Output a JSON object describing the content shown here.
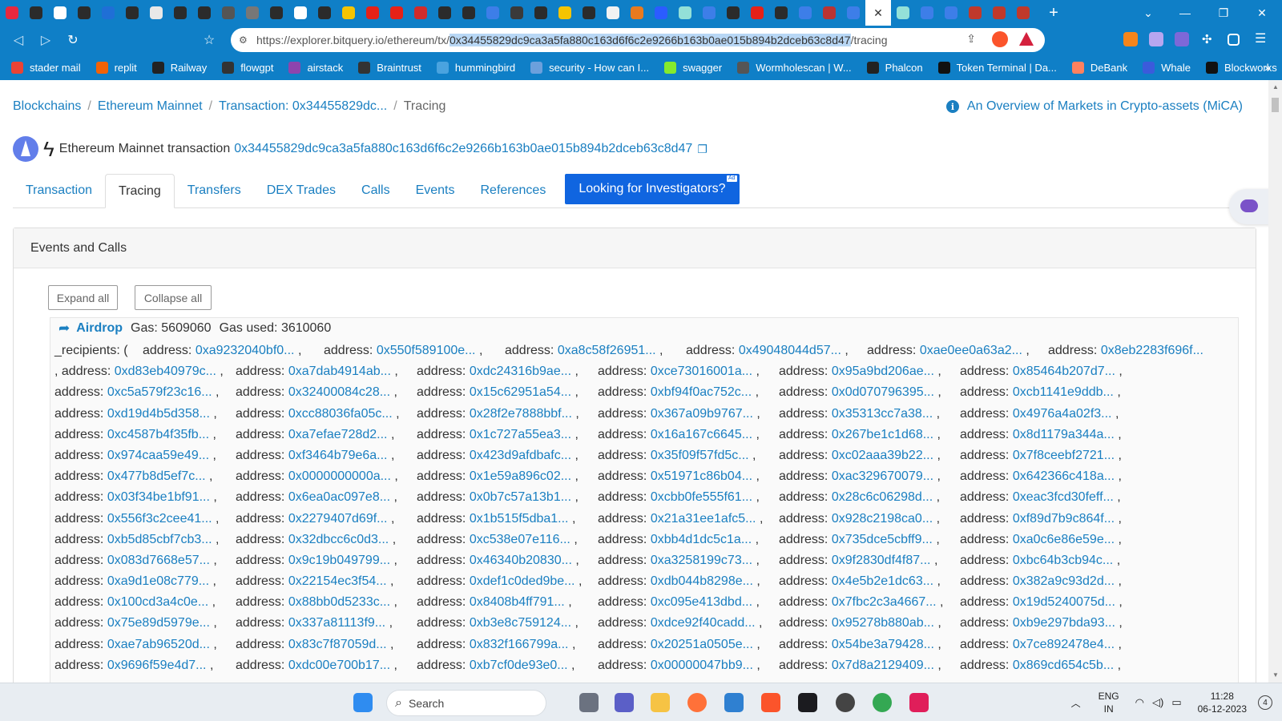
{
  "browser": {
    "tab_favicon_colors": [
      "#e8283e",
      "#2b2b2b",
      "#ffffff",
      "#2b2b2b",
      "#1f6fd6",
      "#2b2b2b",
      "#e8e8e8",
      "#2b2b2b",
      "#2b2b2b",
      "#555555",
      "#777777",
      "#2b2b2b",
      "#ffffff",
      "#2b2b2b",
      "#f5c400",
      "#e62117",
      "#e62117",
      "#d22b2b",
      "#2b2b2b",
      "#2b2b2b",
      "#3d7ee8",
      "#3a3a3a",
      "#2b2b2b",
      "#f5c400",
      "#2b2b2b",
      "#f2f2f2",
      "#e97a1f",
      "#2b5cff",
      "#93e0d8",
      "#3d7ee8",
      "#2b2b2b",
      "#e62117",
      "#2b2b2b",
      "#3d7ee8",
      "#b33",
      "#3d7ee8",
      "#93e0d8",
      "#3d7ee8",
      "#3d7ee8",
      "#c0392b",
      "#c0392b",
      "#c0392b"
    ],
    "active_tab_close": "✕",
    "new_tab": "+",
    "address": {
      "prefix": "https://explorer.bitquery.io/ethereum/tx/",
      "highlighted": "0x34455829dc9ca3a5fa880c163d6f6c2e9266b163b0ae015b894b2dceb63c8d47",
      "suffix": "/tracing"
    },
    "bookmarks": [
      {
        "label": "stader mail",
        "color": "#ea4335"
      },
      {
        "label": "replit",
        "color": "#f26207"
      },
      {
        "label": "Railway",
        "color": "#222222"
      },
      {
        "label": "flowgpt",
        "color": "#333333"
      },
      {
        "label": "airstack",
        "color": "#8e44ad"
      },
      {
        "label": "Braintrust",
        "color": "#333333"
      },
      {
        "label": "hummingbird",
        "color": "#4aa3df"
      },
      {
        "label": "security - How can I...",
        "color": "#6ca0dc"
      },
      {
        "label": "swagger",
        "color": "#85ea2d"
      },
      {
        "label": "Wormholescan | W...",
        "color": "#555555"
      },
      {
        "label": "Phalcon",
        "color": "#222222"
      },
      {
        "label": "Token Terminal | Da...",
        "color": "#111111"
      },
      {
        "label": "DeBank",
        "color": "#fe815f"
      },
      {
        "label": "Whale",
        "color": "#3b5bdb"
      },
      {
        "label": "Blockworks",
        "color": "#111111"
      }
    ],
    "bookmarks_more": "»"
  },
  "page": {
    "breadcrumb": [
      "Blockchains",
      "Ethereum Mainnet",
      "Transaction: 0x34455829dc...",
      "Tracing"
    ],
    "mica_link": "An Overview of Markets in Crypto-assets (MiCA)",
    "tx_label": "Ethereum Mainnet transaction",
    "tx_hash": "0x34455829dc9ca3a5fa880c163d6f6c2e9266b163b0ae015b894b2dceb63c8d47",
    "tabs": [
      "Transaction",
      "Tracing",
      "Transfers",
      "DEX Trades",
      "Calls",
      "Events",
      "References"
    ],
    "active_tab": "Tracing",
    "promo_button": "Looking for Investigators?",
    "promo_ad": "Ad",
    "card_title": "Events and Calls",
    "expand_all": "Expand all",
    "collapse_all": "Collapse all",
    "trace": {
      "method": "Airdrop",
      "gas": "Gas: 5609060",
      "gas_used": "Gas used: 3610060",
      "param_label": "_recipients: (",
      "address_label": "address:",
      "separator": ",",
      "rows": [
        [
          "0xa9232040bf0...",
          "0x550f589100e...",
          "0xa8c58f26951...",
          "0x49048044d57...",
          "0xae0ee0a63a2...",
          "0x8eb2283f696f..."
        ],
        [
          "0xd83eb40979c...",
          "0xa7dab4914ab...",
          "0xdc24316b9ae...",
          "0xce73016001a...",
          "0x95a9bd206ae...",
          "0x85464b207d7..."
        ],
        [
          "0xc5a579f23c16...",
          "0x32400084c28...",
          "0x15c62951a54...",
          "0xbf94f0ac752c...",
          "0x0d070796395...",
          "0xcb1141e9ddb..."
        ],
        [
          "0xd19d4b5d358...",
          "0xcc88036fa05c...",
          "0x28f2e7888bbf...",
          "0x367a09b9767...",
          "0x35313cc7a38...",
          "0x4976a4a02f3..."
        ],
        [
          "0xc4587b4f35fb...",
          "0xa7efae728d2...",
          "0x1c727a55ea3...",
          "0x16a167c6645...",
          "0x267be1c1d68...",
          "0x8d1179a344a..."
        ],
        [
          "0x974caa59e49...",
          "0xf3464b79e6a...",
          "0x423d9afdbafc...",
          "0x35f09f57fd5c...",
          "0xc02aaa39b22...",
          "0x7f8ceebf2721..."
        ],
        [
          "0x477b8d5ef7c...",
          "0x0000000000a...",
          "0x1e59a896c02...",
          "0x51971c86b04...",
          "0xac329670079...",
          "0x642366c418a..."
        ],
        [
          "0x03f34be1bf91...",
          "0x6ea0ac097e8...",
          "0x0b7c57a13b1...",
          "0xcbb0fe555f61...",
          "0x28c6c06298d...",
          "0xeac3fcd30feff..."
        ],
        [
          "0x556f3c2cee41...",
          "0x2279407d69f...",
          "0x1b515f5dba1...",
          "0x21a31ee1afc5...",
          "0x928c2198ca0...",
          "0xf89d7b9c864f..."
        ],
        [
          "0xb5d85cbf7cb3...",
          "0x32dbcc6c0d3...",
          "0xc538e07e116...",
          "0xbb4d1dc5c1a...",
          "0x735dce5cbff9...",
          "0xa0c6e86e59e..."
        ],
        [
          "0x083d7668e57...",
          "0x9c19b049799...",
          "0x46340b20830...",
          "0xa3258199c73...",
          "0x9f2830df4f87...",
          "0xbc64b3cb94c..."
        ],
        [
          "0xa9d1e08c779...",
          "0x22154ec3f54...",
          "0xdef1c0ded9be...",
          "0xdb044b8298e...",
          "0x4e5b2e1dc63...",
          "0x382a9c93d2d..."
        ],
        [
          "0x100cd3a4c0e...",
          "0x88bb0d5233c...",
          "0x8408b4ff791...",
          "0xc095e413dbd...",
          "0x7fbc2c3a4667...",
          "0x19d5240075d..."
        ],
        [
          "0x75e89d5979e...",
          "0x337a81113f9...",
          "0xb3e8c759124...",
          "0xdce92f40cadd...",
          "0x95278b880ab...",
          "0xb9e297bda93..."
        ],
        [
          "0xae7ab96520d...",
          "0x83c7f87059d...",
          "0x832f166799a...",
          "0x20251a0505e...",
          "0x54be3a79428...",
          "0x7ce892478e4..."
        ],
        [
          "0x9696f59e4d7...",
          "0xdc00e700b17...",
          "0xb7cf0de93e0...",
          "0x00000047bb9...",
          "0x7d8a2129409...",
          "0x869cd654c5b..."
        ]
      ]
    }
  },
  "taskbar": {
    "search_label": "Search",
    "language": "ENG",
    "region": "IN",
    "time": "11:28",
    "date": "06-12-2023",
    "notifications": "4"
  }
}
